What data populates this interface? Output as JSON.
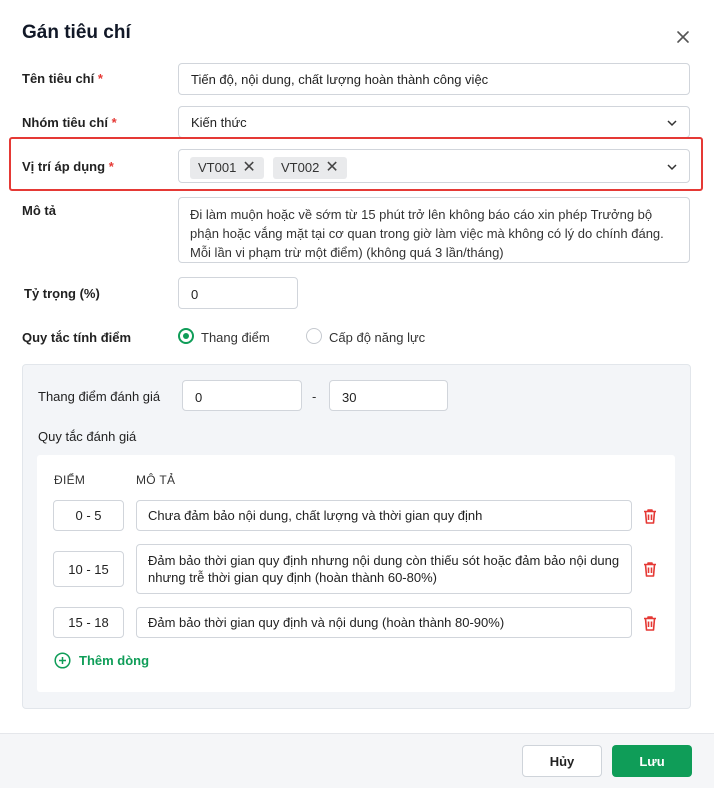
{
  "dialog": {
    "title": "Gán tiêu chí"
  },
  "fields": {
    "name_label": "Tên tiêu chí",
    "name_value": "Tiến độ, nội dung, chất lượng hoàn thành công việc",
    "group_label": "Nhóm tiêu chí",
    "group_value": "Kiến thức",
    "position_label": "Vị trí áp dụng",
    "positions": [
      "VT001",
      "VT002"
    ],
    "desc_label": "Mô tả",
    "desc_value": "Đi làm muộn hoặc về sớm từ 15 phút trở lên không báo cáo xin phép Trưởng bộ phận hoặc vắng mặt tại cơ quan trong giờ làm việc mà không có lý do chính đáng. Mỗi lần vi phạm trừ một điểm) (không quá 3 lần/tháng)",
    "weight_label": "Tỷ trọng (%)",
    "weight_value": "0",
    "rule_label": "Quy tắc tính điểm",
    "required_mark": "*"
  },
  "scoring": {
    "options": [
      "Thang điểm",
      "Cấp độ năng lực"
    ],
    "selected": "Thang điểm",
    "scale_label": "Thang điểm đánh giá",
    "scale_min": "0",
    "scale_sep": "-",
    "scale_max": "30",
    "rules_label": "Quy tắc đánh giá",
    "col_score": "ĐIỂM",
    "col_desc": "MÔ TẢ",
    "rows": [
      {
        "score": "0 - 5",
        "desc": "Chưa đảm bảo nội dung, chất lượng và thời gian quy định"
      },
      {
        "score": "10 - 15",
        "desc": "Đảm bảo thời gian quy định nhưng nội dung còn thiếu sót hoặc đảm bảo nội dung nhưng trễ thời gian quy định (hoàn thành 60-80%)"
      },
      {
        "score": "15 - 18",
        "desc": "Đảm bảo thời gian quy định và nội dung (hoàn thành 80-90%)"
      }
    ],
    "add_row": "Thêm dòng"
  },
  "footer": {
    "cancel": "Hủy",
    "save": "Lưu"
  },
  "colors": {
    "accent": "#0f9d58",
    "required": "#e53935",
    "highlight": "#e53935",
    "delete": "#e53935"
  },
  "icons": {
    "close": "close-icon",
    "chevron": "chevron-down-icon",
    "remove": "remove-chip-icon",
    "trash": "trash-icon",
    "add": "plus-circle-icon"
  }
}
